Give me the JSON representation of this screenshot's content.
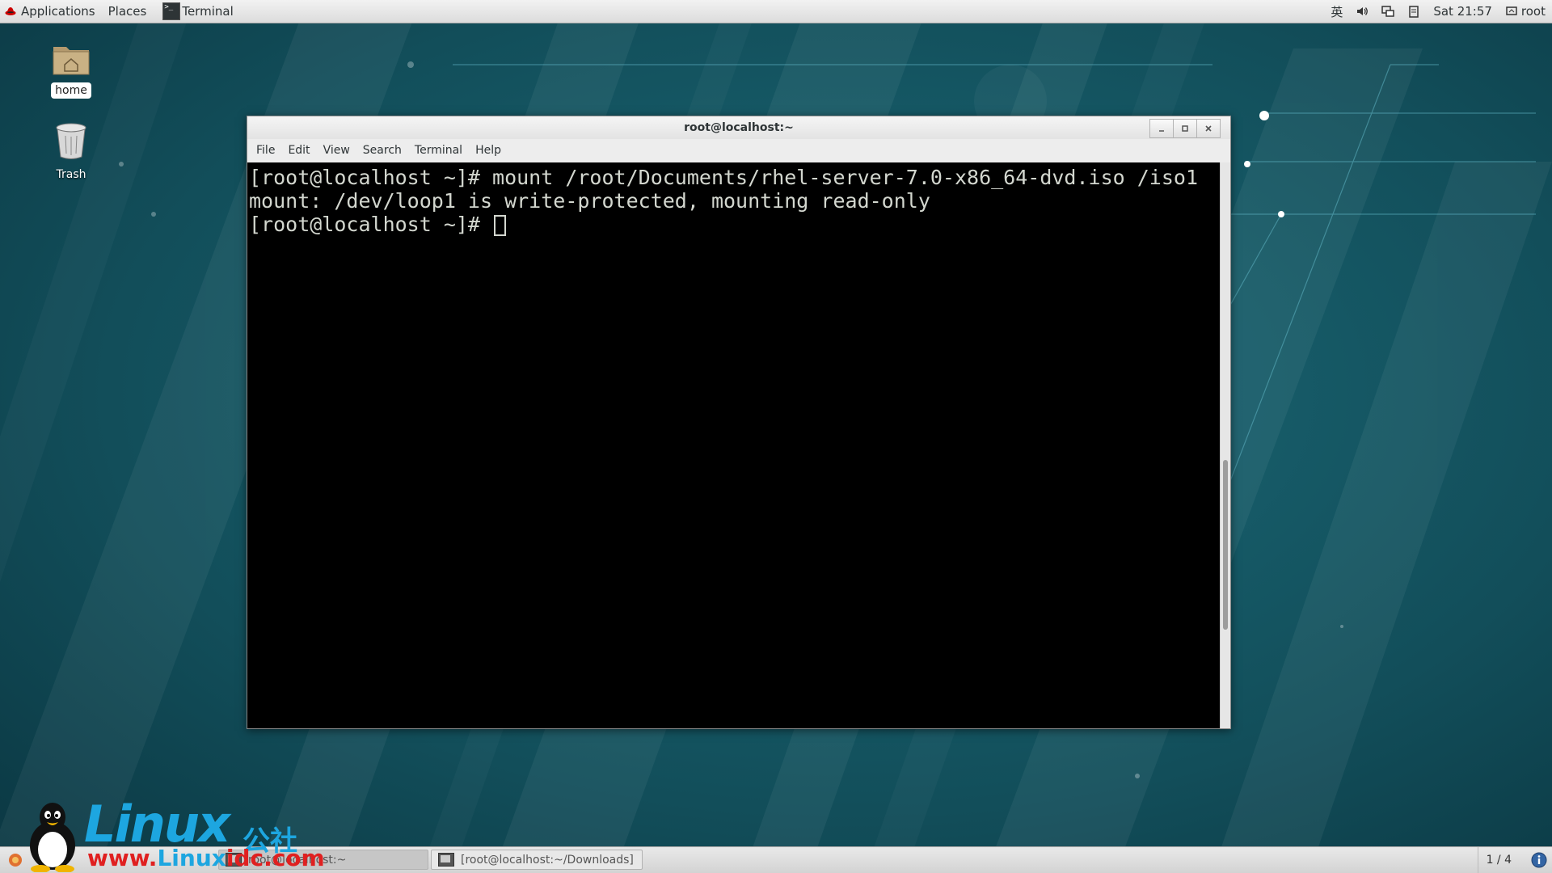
{
  "top_panel": {
    "applications": "Applications",
    "places": "Places",
    "active_task": "Terminal",
    "input_method": "英",
    "clock": "Sat 21:57",
    "user": "root"
  },
  "desktop": {
    "icons": [
      {
        "label": "home",
        "icon": "home-folder-icon"
      },
      {
        "label": "Trash",
        "icon": "trash-icon"
      }
    ]
  },
  "terminal_window": {
    "title": "root@localhost:~",
    "menu": [
      "File",
      "Edit",
      "View",
      "Search",
      "Terminal",
      "Help"
    ],
    "lines": [
      "[root@localhost ~]# mount /root/Documents/rhel-server-7.0-x86_64-dvd.iso /iso1",
      "mount: /dev/loop1 is write-protected, mounting read-only",
      "[root@localhost ~]# "
    ],
    "scroll_position": 0.75,
    "scroll_visible_fraction": 0.3
  },
  "bottom_panel": {
    "tasks": [
      {
        "label": "root@localhost:~",
        "active": true
      },
      {
        "label": "[root@localhost:~/Downloads]",
        "active": false
      }
    ],
    "workspace": "1 / 4"
  },
  "watermark": {
    "brand": "Linux",
    "brand_cn": "公社",
    "url_prefix": "www.",
    "url_accent": "Linux",
    "url_suffix": "idc.com"
  },
  "colors": {
    "desktop_bg": "#0f4b57",
    "terminal_bg": "#000000",
    "terminal_fg": "#d3d7cf",
    "watermark_blue": "#1da6e0",
    "watermark_red": "#e02020"
  }
}
